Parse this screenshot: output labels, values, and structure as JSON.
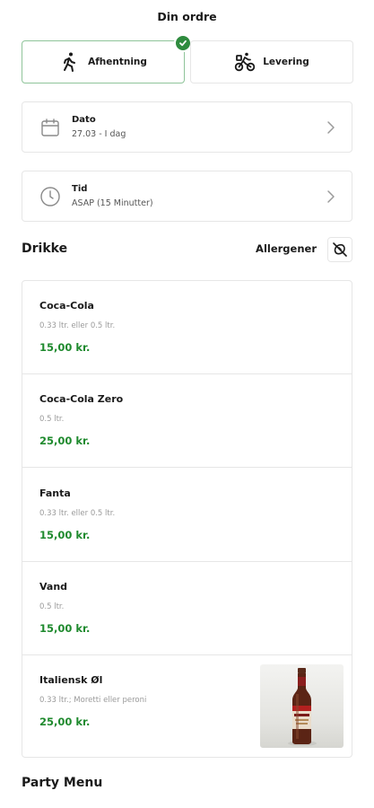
{
  "header": {
    "title": "Din ordre"
  },
  "order_mode": {
    "selected": "pickup",
    "options": [
      {
        "id": "pickup",
        "label": "Afhentning",
        "icon": "walking-person-icon"
      },
      {
        "id": "delivery",
        "label": "Levering",
        "icon": "cyclist-icon"
      }
    ]
  },
  "date_row": {
    "title": "Dato",
    "value": "27.03 - I dag",
    "icon": "calendar-icon"
  },
  "time_row": {
    "title": "Tid",
    "value": "ASAP (15 Minutter)",
    "icon": "clock-icon"
  },
  "category": {
    "title": "Drikke",
    "allergen_label": "Allergener",
    "items": [
      {
        "name": "Coca-Cola",
        "description": "0.33 ltr. eller 0.5 ltr.",
        "price": "15,00 kr."
      },
      {
        "name": "Coca-Cola Zero",
        "description": "0.5 ltr.",
        "price": "25,00 kr."
      },
      {
        "name": "Fanta",
        "description": "0.33 ltr. eller 0.5 ltr.",
        "price": "15,00 kr."
      },
      {
        "name": "Vand",
        "description": "0.5 ltr.",
        "price": "15,00 kr."
      },
      {
        "name": "Italiensk Øl",
        "description": "0.33 ltr.; Moretti eller peroni",
        "price": "25,00 kr."
      }
    ]
  },
  "next_category": {
    "title": "Party Menu"
  },
  "colors": {
    "accent_green": "#2e8b3e",
    "price_green": "#1f8a2e",
    "border": "#e6e6e6"
  }
}
